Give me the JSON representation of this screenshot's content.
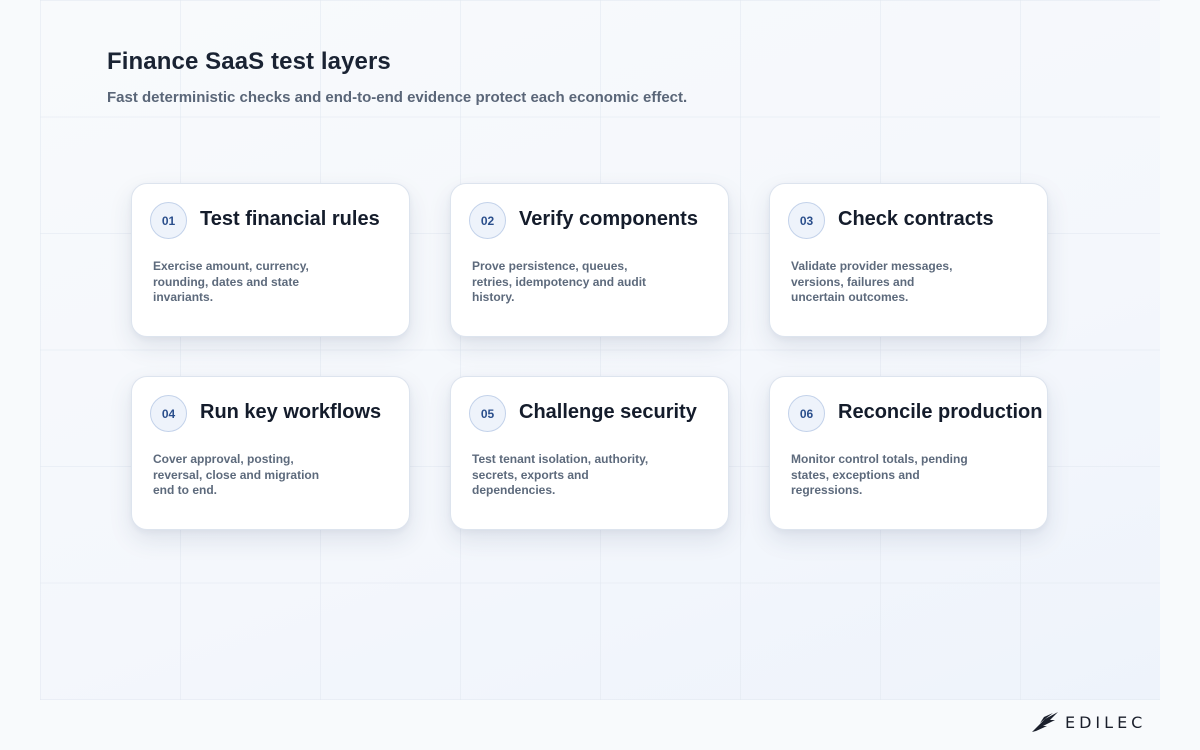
{
  "header": {
    "title": "Finance SaaS test layers",
    "subtitle": "Fast deterministic checks and end-to-end evidence protect each economic effect."
  },
  "cards": [
    {
      "number": "01",
      "title": "Test financial rules",
      "description": "Exercise amount, currency, rounding, dates and state invariants."
    },
    {
      "number": "02",
      "title": "Verify components",
      "description": "Prove persistence, queues, retries, idempotency and audit history."
    },
    {
      "number": "03",
      "title": "Check contracts",
      "description": "Validate provider messages, versions, failures and uncertain outcomes."
    },
    {
      "number": "04",
      "title": "Run key workflows",
      "description": "Cover approval, posting, reversal, close and migration end to end."
    },
    {
      "number": "05",
      "title": "Challenge security",
      "description": "Test tenant isolation, authority, secrets, exports and dependencies."
    },
    {
      "number": "06",
      "title": "Reconcile production",
      "description": "Monitor control totals, pending states, exceptions and regressions."
    }
  ],
  "brand": {
    "name": "EDILEC",
    "logo_icon": "bird-wing-icon"
  },
  "colors": {
    "title": "#1a2333",
    "subtitle": "#5a6678",
    "badge_text": "#2b4f8c",
    "badge_border": "#c3d2ea",
    "card_bg": "#ffffff"
  }
}
